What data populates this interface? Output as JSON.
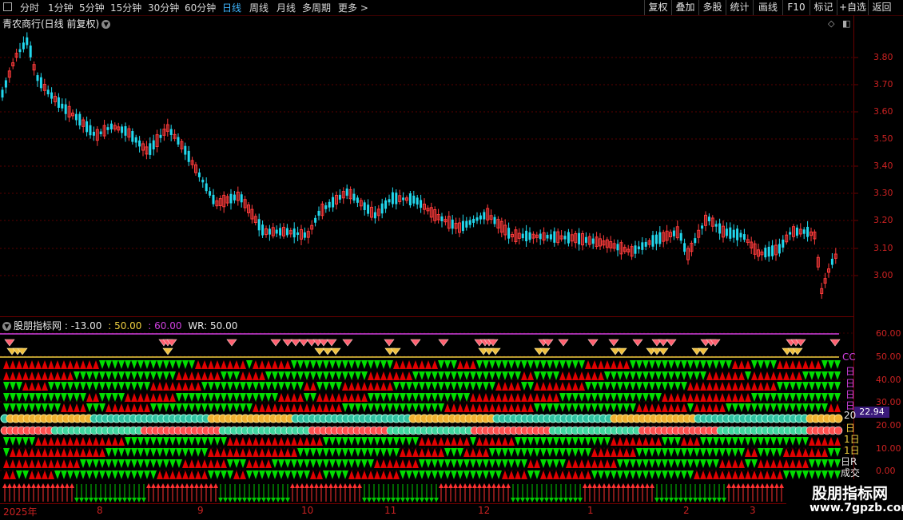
{
  "toolbar": {
    "periods": [
      "分时",
      "1分钟",
      "5分钟",
      "15分钟",
      "30分钟",
      "60分钟",
      "日线",
      "周线",
      "月线",
      "多周期",
      "更多 >"
    ],
    "active_period": "日线",
    "tools": [
      "复权",
      "叠加",
      "多股",
      "统计",
      "画线",
      "F10",
      "标记",
      "+自选",
      "返回"
    ]
  },
  "stock": {
    "title": "青农商行(日线 前复权)"
  },
  "price_axis": {
    "labels": [
      "3.80",
      "3.70",
      "3.60",
      "3.50",
      "3.40",
      "3.30",
      "3.20",
      "3.10",
      "3.00"
    ]
  },
  "indicator": {
    "name": "股朋指标网",
    "v1": ": -13.00",
    "v2": ": 50.00",
    "v3": ": 60.00",
    "v4": "WR: 50.00",
    "axis_labels": [
      "60.00",
      "50.00",
      "40.00",
      "30.00",
      "20.00",
      "10.00",
      "0.00"
    ],
    "current_value": "22.94",
    "side_labels": [
      "CC",
      "日",
      "日",
      "日",
      "日",
      "20",
      "日",
      "1日",
      "1日",
      "日R",
      "成交"
    ]
  },
  "date_axis": {
    "labels": [
      "2025年",
      "8",
      "9",
      "10",
      "11",
      "12",
      "1",
      "2",
      "3"
    ]
  },
  "watermark": {
    "line1": "股朋指标网",
    "line2": "www.7gpzb.com"
  },
  "colors": {
    "up": "#ff3b3b",
    "down": "#22d8ee",
    "green": "#00dd00",
    "red": "#e00000",
    "gold": "#f0c040",
    "accent": "#3fb6ff"
  },
  "icons": {
    "diamond": "diamond-icon",
    "dropdown": "chevron-down-icon"
  }
}
